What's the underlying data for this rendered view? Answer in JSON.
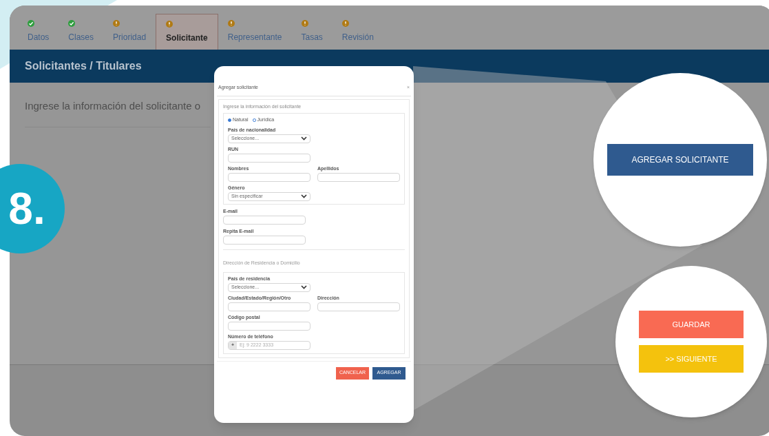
{
  "step_badge": "8.",
  "tabs": [
    {
      "label": "Datos",
      "complete": true,
      "selected": false
    },
    {
      "label": "Clases",
      "complete": true,
      "selected": false
    },
    {
      "label": "Prioridad",
      "complete": false,
      "selected": false
    },
    {
      "label": "Solicitante",
      "complete": false,
      "selected": true
    },
    {
      "label": "Representante",
      "complete": false,
      "selected": false
    },
    {
      "label": "Tasas",
      "complete": false,
      "selected": false
    },
    {
      "label": "Revisión",
      "complete": false,
      "selected": false
    }
  ],
  "section_header": "Solicitantes / Titulares",
  "intro_text": "Ingrese la información del solicitante o",
  "dialog": {
    "title": "Agregar solicitante",
    "close": "×",
    "subtitle": "Ingrese la información del solicitante",
    "person_types": [
      {
        "label": "Natural",
        "selected": true
      },
      {
        "label": "Jurídica",
        "selected": false
      }
    ],
    "personal_fields": [
      {
        "kind": "select",
        "label": "País de nacionalidad",
        "value": "Seleccione..."
      },
      {
        "kind": "input",
        "label": "RUN"
      },
      {
        "kind": "pair",
        "label": "Nombres",
        "label_2": "Apellidos"
      },
      {
        "kind": "select",
        "label": "Género",
        "value": "Sin especificar"
      }
    ],
    "email_fields": [
      {
        "label": "E-mail"
      },
      {
        "label": "Repita E-mail"
      }
    ],
    "address_heading": "Dirección de Residencia o Domicilio",
    "address_fields": [
      {
        "kind": "select",
        "label": "País de residencia",
        "value": "Seleccione..."
      },
      {
        "kind": "pair",
        "label": "Ciudad/Estado/Región/Otro",
        "label_2": "Dirección"
      },
      {
        "kind": "input",
        "label": "Código postal"
      },
      {
        "kind": "phone",
        "label": "Número de teléfono",
        "prefix": "+",
        "placeholder": "Ej: 9 2222 3333"
      }
    ],
    "buttons": [
      {
        "label": "CANCELAR",
        "kind": "danger"
      },
      {
        "label": "AGREGAR",
        "kind": "primary"
      }
    ]
  },
  "zoom_add": {
    "label": "AGREGAR SOLICITANTE"
  },
  "zoom_actions": [
    {
      "label": "GUARDAR",
      "kind": "save"
    },
    {
      "label": ">> SIGUIENTE",
      "kind": "next"
    }
  ]
}
